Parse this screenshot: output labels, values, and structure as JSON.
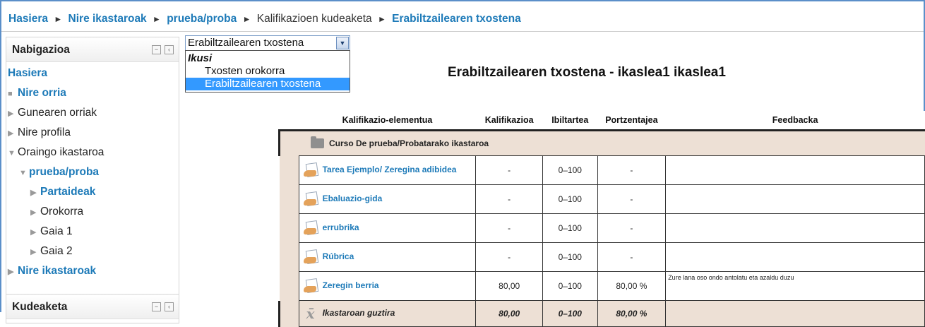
{
  "breadcrumb": {
    "home": "Hasiera",
    "my_courses": "Nire ikastaroak",
    "course": "prueba/proba",
    "grade_admin": "Kalifikazioen kudeaketa",
    "user_report": "Erabiltzailearen txostena"
  },
  "nav": {
    "title": "Nabigazioa",
    "home": "Hasiera",
    "my_home": "Nire orria",
    "site_pages": "Gunearen orriak",
    "profile": "Nire profila",
    "current_course": "Oraingo ikastaroa",
    "course": "prueba/proba",
    "participants": "Partaideak",
    "general": "Orokorra",
    "topic1": "Gaia 1",
    "topic2": "Gaia 2",
    "my_courses": "Nire ikastaroak"
  },
  "admin": {
    "title": "Kudeaketa"
  },
  "report_select": {
    "value": "Erabiltzailearen txostena",
    "group_label": "Ikusi",
    "options": [
      "Txosten orokorra",
      "Erabiltzailearen txostena"
    ]
  },
  "report_title": "Erabiltzailearen txostena - ikaslea1 ikaslea1",
  "table": {
    "headers": [
      "Kalifikazio-elementua",
      "Kalifikazioa",
      "Ibiltartea",
      "Portzentajea",
      "Feedbacka"
    ],
    "category": "Curso De prueba/Probatarako ikastaroa",
    "rows": [
      {
        "name": "Tarea Ejemplo/ Zeregina adibidea",
        "grade": "-",
        "range": "0–100",
        "percent": "-",
        "feedback": ""
      },
      {
        "name": "Ebaluazio-gida",
        "grade": "-",
        "range": "0–100",
        "percent": "-",
        "feedback": ""
      },
      {
        "name": "errubrika",
        "grade": "-",
        "range": "0–100",
        "percent": "-",
        "feedback": ""
      },
      {
        "name": "Rúbrica",
        "grade": "-",
        "range": "0–100",
        "percent": "-",
        "feedback": ""
      },
      {
        "name": "Zeregin berria",
        "grade": "80,00",
        "range": "0–100",
        "percent": "80,00 %",
        "feedback": "Zure lana oso ondo antolatu eta azaldu duzu"
      }
    ],
    "total": {
      "name": "Ikastaroan guztira",
      "grade": "80,00",
      "range": "0–100",
      "percent": "80,00 %"
    }
  }
}
